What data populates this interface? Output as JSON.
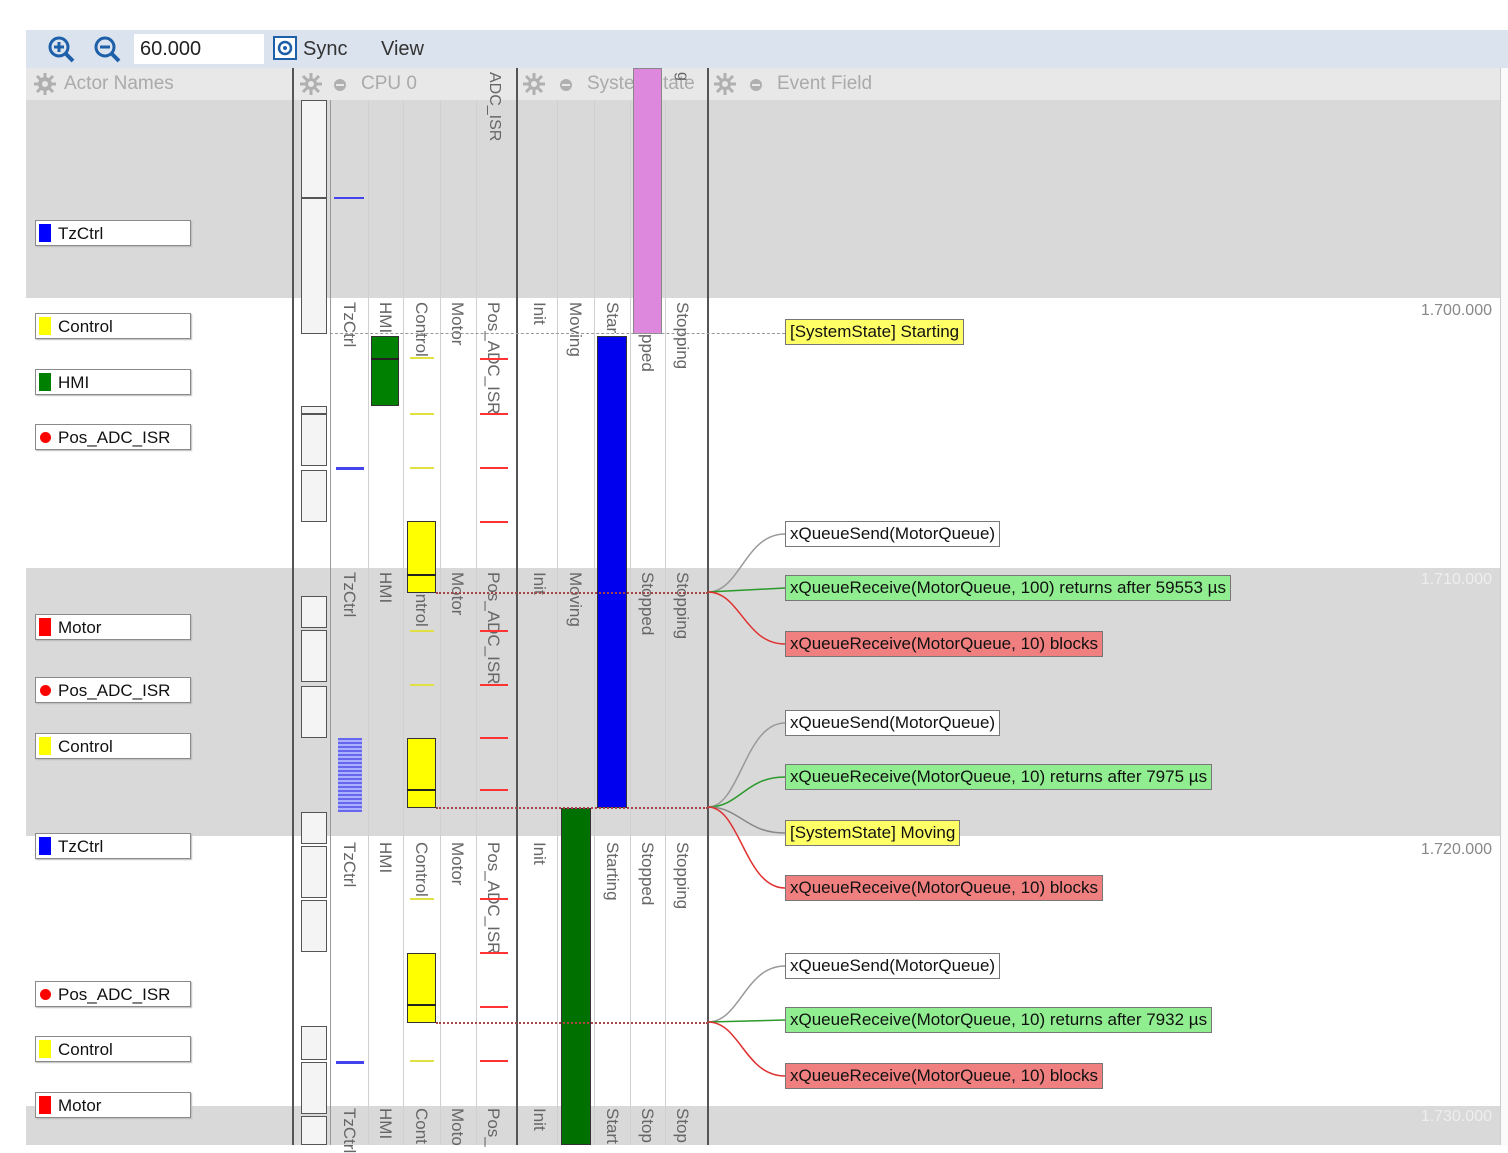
{
  "toolbar": {
    "zoom_in_icon": "zoom-in-icon",
    "zoom_out_icon": "zoom-out-icon",
    "zoom_value": "60.000",
    "dropdown_icon": "chevron-down-icon",
    "sync_label": "Sync",
    "view_label": "View"
  },
  "headers": {
    "actor_names": "Actor Names",
    "cpu": "CPU 0",
    "system_state": "SystemState",
    "event_field": "Event Field",
    "adc_isr": "ADC_ISR",
    "truncated": "g"
  },
  "actors": [
    {
      "label": "TzCtrl",
      "color": "#0000ff",
      "marker": "square"
    },
    {
      "label": "Control",
      "color": "#ffff00",
      "marker": "square"
    },
    {
      "label": "HMI",
      "color": "#008000",
      "marker": "square"
    },
    {
      "label": "Pos_ADC_ISR",
      "color": "#ff0000",
      "marker": "dot"
    },
    {
      "label": "Motor",
      "color": "#ff0000",
      "marker": "square"
    },
    {
      "label": "Pos_ADC_ISR",
      "color": "#ff0000",
      "marker": "dot"
    },
    {
      "label": "Control",
      "color": "#ffff00",
      "marker": "square"
    },
    {
      "label": "TzCtrl",
      "color": "#0000ff",
      "marker": "square"
    },
    {
      "label": "Pos_ADC_ISR",
      "color": "#ff0000",
      "marker": "dot"
    },
    {
      "label": "Control",
      "color": "#ffff00",
      "marker": "square"
    },
    {
      "label": "Motor",
      "color": "#ff0000",
      "marker": "square"
    }
  ],
  "cpu_columns": {
    "full": [
      "TzCtrl",
      "HMI",
      "Control",
      "Motor",
      "Pos_ADC_ISR"
    ],
    "block2": [
      "TzCtrl",
      "HMI",
      "Control",
      "Motor",
      "Pos_ADC_ISR"
    ],
    "block3": [
      "TzCtrl",
      "HMI",
      "Control",
      "Motor",
      "Pos_ADC_ISR"
    ],
    "block4": [
      "TzCtrl",
      "HMI",
      "Cont",
      "Moto",
      "Pos_"
    ]
  },
  "state_columns": {
    "block1": [
      "Init",
      "Moving",
      "Star",
      "pped",
      "Stopping"
    ],
    "block2": [
      "Init",
      "Moving",
      "Stopped",
      "Stopping"
    ],
    "block3": [
      "Init",
      "Starting",
      "Stopped",
      "Stopping"
    ],
    "block4": [
      "Init",
      "Start",
      "Stop",
      "Stop"
    ]
  },
  "events": [
    {
      "text": "[SystemState] Starting",
      "style": "yellow"
    },
    {
      "text": "xQueueSend(MotorQueue)",
      "style": "white"
    },
    {
      "text": "xQueueReceive(MotorQueue, 100) returns after 59553 µs",
      "style": "green"
    },
    {
      "text": "xQueueReceive(MotorQueue, 10) blocks",
      "style": "red"
    },
    {
      "text": "xQueueSend(MotorQueue)",
      "style": "white"
    },
    {
      "text": "xQueueReceive(MotorQueue, 10) returns after 7975 µs",
      "style": "green"
    },
    {
      "text": "[SystemState] Moving",
      "style": "yellow"
    },
    {
      "text": "xQueueReceive(MotorQueue, 10) blocks",
      "style": "red"
    },
    {
      "text": "xQueueSend(MotorQueue)",
      "style": "white"
    },
    {
      "text": "xQueueReceive(MotorQueue, 10) returns after 7932 µs",
      "style": "green"
    },
    {
      "text": "xQueueReceive(MotorQueue, 10) blocks",
      "style": "red"
    }
  ],
  "timestamps": [
    "1.700.000",
    "1.710.000",
    "1.720.000",
    "1.730.000"
  ],
  "colors": {
    "tzctrl": "#0000ff",
    "hmi": "#008000",
    "control": "#ffff00",
    "isr": "#ff0000",
    "state_starting": "#0000ee",
    "state_moving": "#007000",
    "state_stopped": "#dd88dd"
  }
}
